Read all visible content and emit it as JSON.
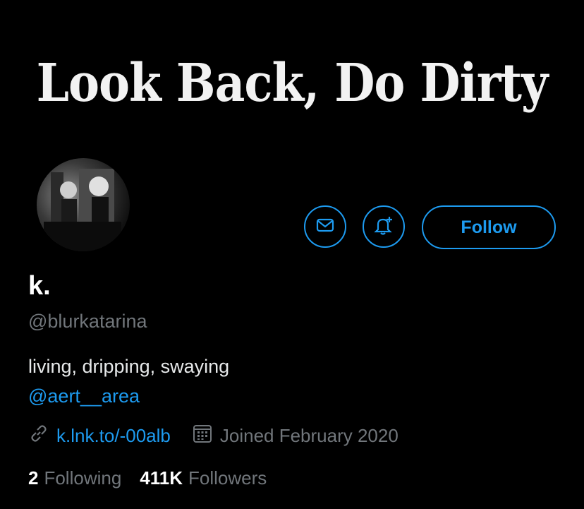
{
  "banner": {
    "title": "Look Back, Do Dirty"
  },
  "profile": {
    "name": "k.",
    "handle": "@blurkatarina",
    "bio": "living, dripping, swaying",
    "mention": "@aert__area",
    "link": "k.lnk.to/-00alb",
    "joined": "Joined February 2020"
  },
  "actions": {
    "follow_label": "Follow"
  },
  "stats": {
    "following_count": "2",
    "following_label": "Following",
    "followers_count": "411K",
    "followers_label": "Followers"
  },
  "colors": {
    "accent": "#1d9bf0",
    "muted": "#71767b",
    "background": "#000000"
  },
  "icons": [
    "mail-icon",
    "bell-plus-icon",
    "link-icon",
    "calendar-icon"
  ]
}
